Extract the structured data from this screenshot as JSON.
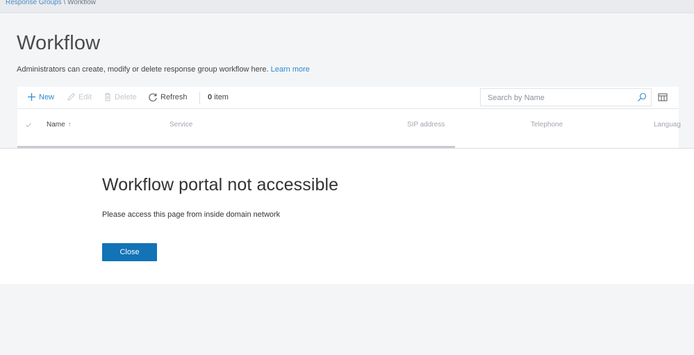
{
  "breadcrumb": {
    "parent": "Response Groups",
    "separator": "\\",
    "current": "Workflow"
  },
  "page": {
    "title": "Workflow",
    "description": "Administrators can create, modify or delete response group workflow here.",
    "learn_more": "Learn more"
  },
  "toolbar": {
    "new_label": "New",
    "edit_label": "Edit",
    "delete_label": "Delete",
    "refresh_label": "Refresh",
    "item_count": "0",
    "item_label": "item",
    "search_placeholder": "Search by Name",
    "icons": {
      "new": "plus-icon",
      "edit": "pencil-icon",
      "delete": "trash-icon",
      "refresh": "refresh-icon",
      "search": "search-icon",
      "columns": "columns-icon"
    }
  },
  "table": {
    "columns": [
      "Name",
      "Service",
      "SIP address",
      "Telephone",
      "Languag"
    ],
    "sort_indicator": "↑"
  },
  "dialog": {
    "title": "Workflow portal not accessible",
    "message": "Please access this page from inside domain network",
    "close_label": "Close"
  },
  "colors": {
    "accent": "#2a8ad2",
    "primary_button": "#1273b6",
    "background": "#f4f5f7"
  }
}
